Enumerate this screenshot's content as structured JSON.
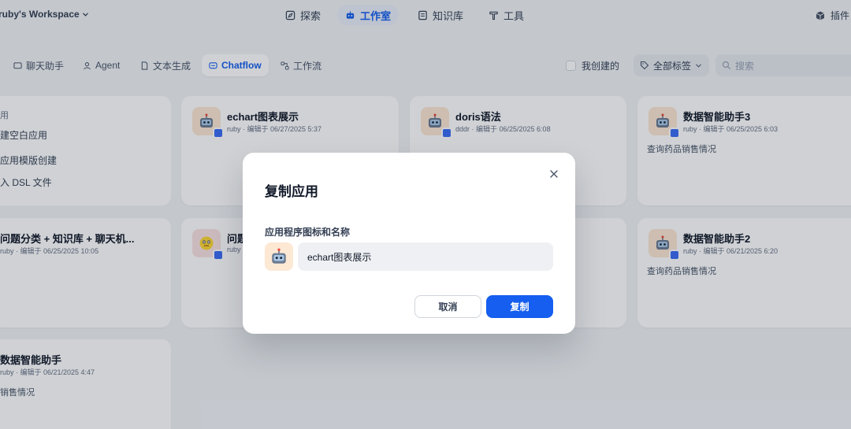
{
  "header": {
    "workspace": "ruby's Workspace",
    "nav": [
      {
        "label": "探索",
        "icon": "compass-icon"
      },
      {
        "label": "工作室",
        "icon": "robot-icon",
        "active": true
      },
      {
        "label": "知识库",
        "icon": "book-icon"
      },
      {
        "label": "工具",
        "icon": "hammer-icon"
      }
    ],
    "plugins": "插件"
  },
  "tabs": [
    {
      "label": "聊天助手",
      "icon": "chat-icon"
    },
    {
      "label": "Agent",
      "icon": "agent-icon"
    },
    {
      "label": "文本生成",
      "icon": "document-icon"
    },
    {
      "label": "Chatflow",
      "icon": "chatflow-icon",
      "active": true
    },
    {
      "label": "工作流",
      "icon": "workflow-icon"
    }
  ],
  "filters": {
    "created_by_me": "我创建的",
    "all_tags": "全部标签",
    "search_placeholder": "搜索"
  },
  "create_card": {
    "heading": "用",
    "options": [
      "建空白应用",
      "应用模版创建",
      "入 DSL 文件"
    ]
  },
  "cards": [
    {
      "title": "echart图表展示",
      "meta": "ruby · 编辑于 06/27/2025 5:37",
      "desc": ""
    },
    {
      "title": "doris语法",
      "meta": "dddr · 编辑于 06/25/2025 6:08",
      "desc": ""
    },
    {
      "title": "数据智能助手3",
      "meta": "ruby · 编辑于 06/25/2025 6:03",
      "desc": "查询药品销售情况"
    },
    {
      "title": "问题分类 + 知识库 + 聊天机...",
      "meta": "ruby · 编辑于 06/25/2025 10:05",
      "desc": ""
    },
    {
      "title": "问题",
      "meta": "ruby",
      "desc": ""
    },
    {
      "title": "数据智能助手2",
      "meta": "ruby · 编辑于 06/21/2025 6:20",
      "desc": "查询药品销售情况"
    },
    {
      "title": "数据智能助手",
      "meta": "ruby · 编辑于 06/21/2025 4:47",
      "desc": "销售情况"
    }
  ],
  "modal": {
    "title": "复制应用",
    "label": "应用程序图标和名称",
    "name_value": "echart图表展示",
    "cancel": "取消",
    "confirm": "复制"
  },
  "colors": {
    "primary": "#155eef",
    "overlay": "rgba(16,24,40,0.20)",
    "icon_bg": "#fde8d4"
  }
}
